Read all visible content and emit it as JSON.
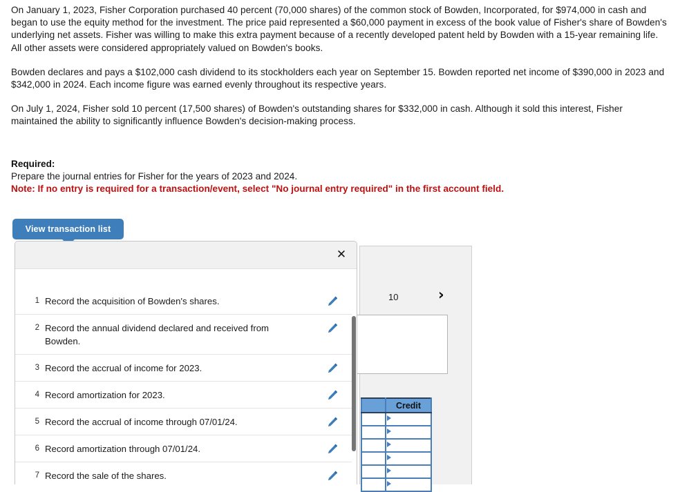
{
  "problem": {
    "paragraphs": [
      "On January 1, 2023, Fisher Corporation purchased 40 percent (70,000 shares) of the common stock of Bowden, Incorporated, for $974,000 in cash and began to use the equity method for the investment. The price paid represented a $60,000 payment in excess of the book value of Fisher's share of Bowden's underlying net assets. Fisher was willing to make this extra payment because of a recently developed patent held by Bowden with a 15-year remaining life. All other assets were considered appropriately valued on Bowden's books.",
      "Bowden declares and pays a $102,000 cash dividend to its stockholders each year on September 15. Bowden reported net income of $390,000 in 2023 and $342,000 in 2024. Each income figure was earned evenly throughout its respective years.",
      "On July 1, 2024, Fisher sold 10 percent (17,500 shares) of Bowden's outstanding shares for $332,000 in cash. Although it sold this interest, Fisher maintained the ability to significantly influence Bowden's decision-making process."
    ]
  },
  "required": {
    "heading": "Required:",
    "instruction": "Prepare the journal entries for Fisher for the years of 2023 and 2024.",
    "note": "Note: If no entry is required for a transaction/event, select \"No journal entry required\" in the first account field."
  },
  "toolbar": {
    "view_transaction_list_label": "View transaction list"
  },
  "popup": {
    "close_label": "✕",
    "transactions": [
      {
        "num": "1",
        "text": "Record the acquisition of Bowden's shares."
      },
      {
        "num": "2",
        "text": "Record the annual dividend declared and received from Bowden."
      },
      {
        "num": "3",
        "text": "Record the accrual of income for 2023."
      },
      {
        "num": "4",
        "text": "Record amortization for 2023."
      },
      {
        "num": "5",
        "text": "Record the accrual of income through 07/01/24."
      },
      {
        "num": "6",
        "text": "Record amortization through 07/01/24."
      },
      {
        "num": "7",
        "text": "Record the sale of the shares."
      }
    ]
  },
  "background": {
    "page_number": "10",
    "next_chevron": "›",
    "credit_header": "Credit",
    "credit_rows_count": 6
  },
  "colors": {
    "accent_blue": "#3d7ebb",
    "table_header_blue": "#6aa0d8",
    "table_border_blue": "#4a7ebb",
    "note_red": "#bb1111",
    "panel_gray": "#f1f1f1"
  }
}
